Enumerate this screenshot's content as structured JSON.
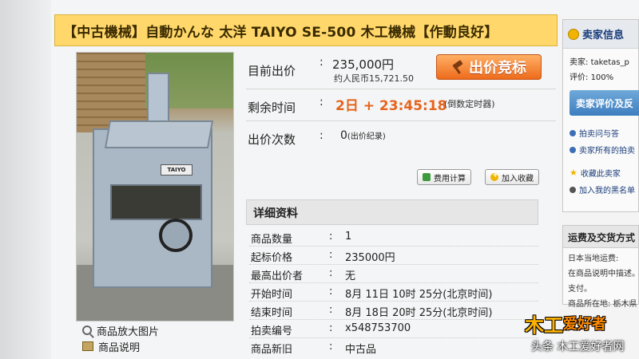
{
  "title": "【中古機械】自動かんな 太洋 TAIYO SE-500 木工機械【作動良好】",
  "photo": {
    "plate_text": "TAIYO",
    "links": [
      {
        "label": "商品放大图片",
        "icon": "magnifier-icon"
      },
      {
        "label": "商品说明",
        "icon": "book-icon"
      }
    ]
  },
  "info": {
    "current_price_label": "目前出价",
    "price_colon": ":",
    "price": "235,000円",
    "price_rmb": "约人民币15,721.50",
    "bid_button": "出价竞标",
    "remaining_label": "剩余时间",
    "remaining_value": "2日 + 23:45:18",
    "countdown_note": "(倒数定时器)",
    "bids_label": "出价次数",
    "bids_value": "0",
    "bids_note": "(出价纪录)",
    "fee_button": "费用计算",
    "fav_button": "加入收藏"
  },
  "details": {
    "header": "详细资料",
    "colon": ":",
    "rows": [
      {
        "key": "商品数量",
        "value": "1"
      },
      {
        "key": "起标价格",
        "value": "235000円"
      },
      {
        "key": "最高出价者",
        "value": "无"
      },
      {
        "key": "开始时间",
        "value": "8月 11日 10时 25分(北京时间)"
      },
      {
        "key": "结束时间",
        "value": "8月 18日 20时 25分(北京时间)"
      },
      {
        "key": "拍卖编号",
        "value": "x548753700"
      },
      {
        "key": "商品新旧",
        "value": "中古品"
      }
    ]
  },
  "seller": {
    "header": "卖家信息",
    "seller_label": "卖家:",
    "seller_value": "taketas_p",
    "rating_label": "评价:",
    "rating_value": "100%",
    "review_button": "卖家评价及反",
    "links": [
      "拍卖问与答",
      "卖家所有的拍卖",
      "收藏此卖家",
      "加入我的黑名单"
    ]
  },
  "shipping": {
    "header": "运费及交货方式",
    "lines": [
      "日本当地运费:",
      "在商品说明中描述。",
      "支付。",
      "商品所在地: 栃木県"
    ]
  },
  "watermark": {
    "logo_main": "木工",
    "logo_text": "爱好者",
    "caption": "头条 木工爱好者网"
  },
  "colors": {
    "title_bg": "#ffd76a",
    "bid_button": "#ee6b1b",
    "time_text": "#e5641e",
    "seller_button": "#3e7ec0"
  }
}
